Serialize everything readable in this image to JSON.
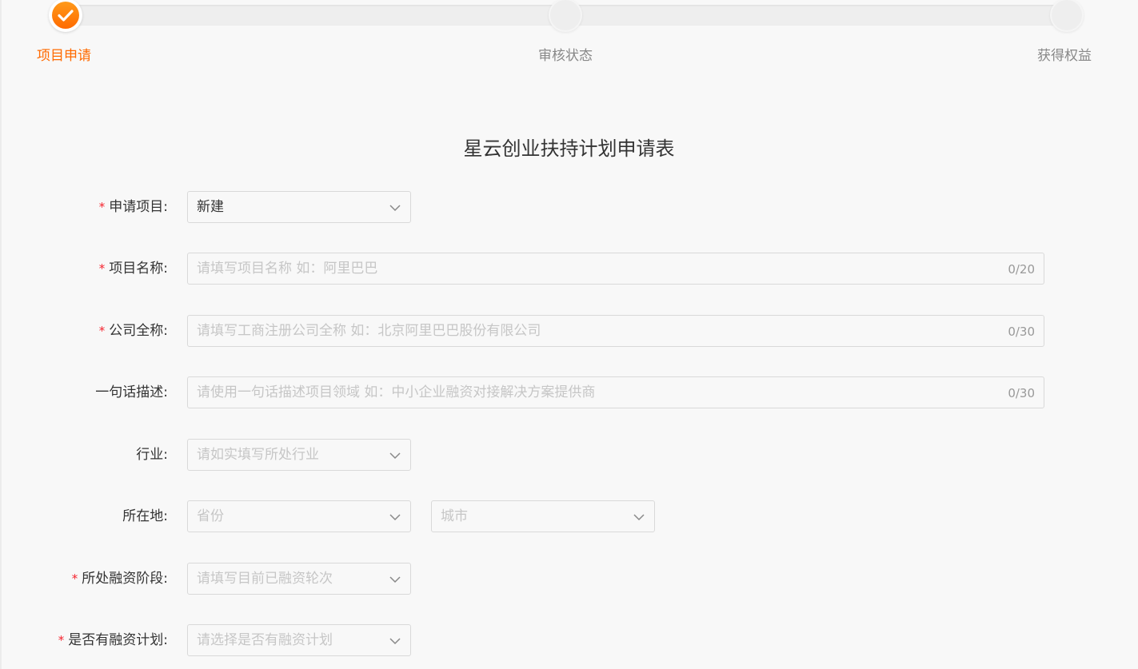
{
  "steps": [
    {
      "label": "项目申请",
      "status": "done"
    },
    {
      "label": "审核状态",
      "status": "pending"
    },
    {
      "label": "获得权益",
      "status": "pending"
    }
  ],
  "form": {
    "title": "星云创业扶持计划申请表",
    "required_mark": "*",
    "fields": {
      "apply_project": {
        "label": "申请项目:",
        "value": "新建"
      },
      "project_name": {
        "label": "项目名称:",
        "placeholder": "请填写项目名称  如：阿里巴巴",
        "counter": "0/20"
      },
      "company_name": {
        "label": "公司全称:",
        "placeholder": "请填写工商注册公司全称  如：北京阿里巴巴股份有限公司",
        "counter": "0/30"
      },
      "description": {
        "label": "一句话描述:",
        "placeholder": "请使用一句话描述项目领域  如：中小企业融资对接解决方案提供商",
        "counter": "0/30"
      },
      "industry": {
        "label": "行业:",
        "placeholder": "请如实填写所处行业"
      },
      "location": {
        "label": "所在地:",
        "province_placeholder": "省份",
        "city_placeholder": "城市"
      },
      "funding_stage": {
        "label": "所处融资阶段:",
        "placeholder": "请填写目前已融资轮次"
      },
      "funding_plan": {
        "label": "是否有融资计划:",
        "placeholder": "请选择是否有融资计划"
      }
    }
  },
  "colors": {
    "accent": "#ff6a00",
    "required": "#f5222d",
    "placeholder": "#c6c6c6",
    "background": "#f8f8f8"
  }
}
